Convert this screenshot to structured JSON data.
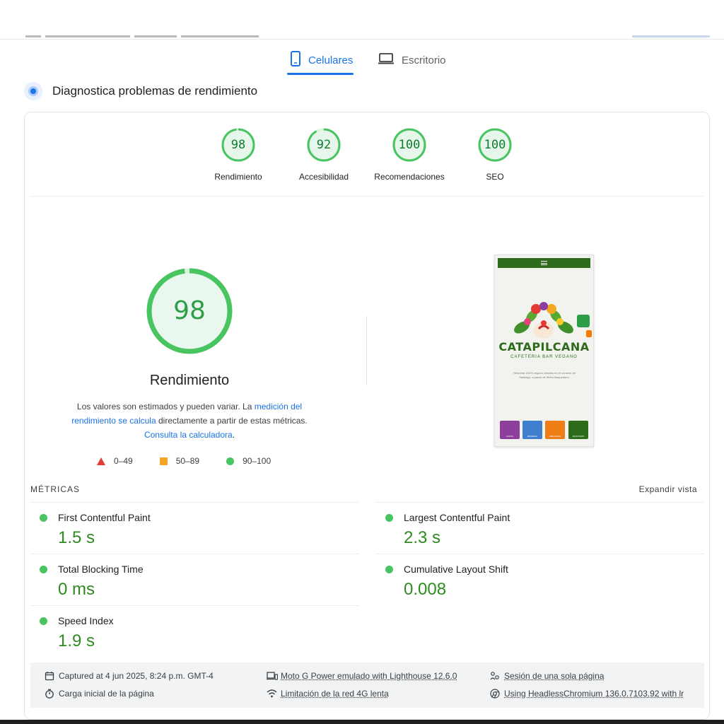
{
  "tabs": [
    {
      "label": "Celulares",
      "active": true,
      "icon": "smartphone-icon"
    },
    {
      "label": "Escritorio",
      "active": false,
      "icon": "laptop-icon"
    }
  ],
  "section": {
    "title": "Diagnostica problemas de rendimiento",
    "icon": "diagnostics-icon"
  },
  "categories": [
    {
      "score": "98",
      "label": "Rendimiento",
      "fraction": 0.98
    },
    {
      "score": "92",
      "label": "Accesibilidad",
      "fraction": 0.92
    },
    {
      "score": "100",
      "label": "Recomendaciones",
      "fraction": 1.0
    },
    {
      "score": "100",
      "label": "SEO",
      "fraction": 1.0
    }
  ],
  "performance": {
    "score": "98",
    "fraction": 0.98,
    "title": "Rendimiento",
    "desc_1": "Los valores son estimados y pueden variar. La ",
    "desc_link_1": "medición del rendimiento se calcula",
    "desc_2": " directamente a partir de estas métricas. ",
    "desc_link_2": "Consulta la calculadora",
    "desc_3": "."
  },
  "legend": [
    {
      "range": "0–49",
      "shape": "triangle",
      "color": "#e53935"
    },
    {
      "range": "50–89",
      "shape": "square",
      "color": "#f4a623"
    },
    {
      "range": "90–100",
      "shape": "circle",
      "color": "#48c460"
    }
  ],
  "screenshot": {
    "logo": "CATAPILCANA",
    "tagline": "CAFETERIA BAR VEGANO",
    "blurb": "Restobar 100% vegano ubicado en el corazón de Santiago, a pasos de Metro Baquedano.",
    "tiles": [
      {
        "caption": "CARTA",
        "color": "#8e3f9e"
      },
      {
        "caption": "RESERVA",
        "color": "#3f7fcf"
      },
      {
        "caption": "UBICACIÓN",
        "color": "#ef7d16"
      },
      {
        "caption": "WHATSAPP",
        "color": "#2d6a1a"
      }
    ]
  },
  "metrics": {
    "heading": "MÉTRICAS",
    "expand_label": "Expandir vista",
    "items": [
      {
        "name": "First Contentful Paint",
        "value": "1.5 s"
      },
      {
        "name": "Largest Contentful Paint",
        "value": "2.3 s"
      },
      {
        "name": "Total Blocking Time",
        "value": "0 ms"
      },
      {
        "name": "Cumulative Layout Shift",
        "value": "0.008"
      },
      {
        "name": "Speed Index",
        "value": "1.9 s"
      }
    ]
  },
  "footer": {
    "captured": "Captured at 4 jun 2025, 8:24 p.m. GMT-4",
    "load": "Carga inicial de la página",
    "device": "Moto G Power emulado with Lighthouse 12.6.0",
    "network": "Limitación de la red 4G lenta",
    "session": "Sesión de una sola página",
    "browser": "Using HeadlessChromium 136.0.7103.92 with lr"
  },
  "colors": {
    "accent": "#1a73e8",
    "pass": "#0cce6b",
    "pass_text": "#2e8b1f"
  }
}
